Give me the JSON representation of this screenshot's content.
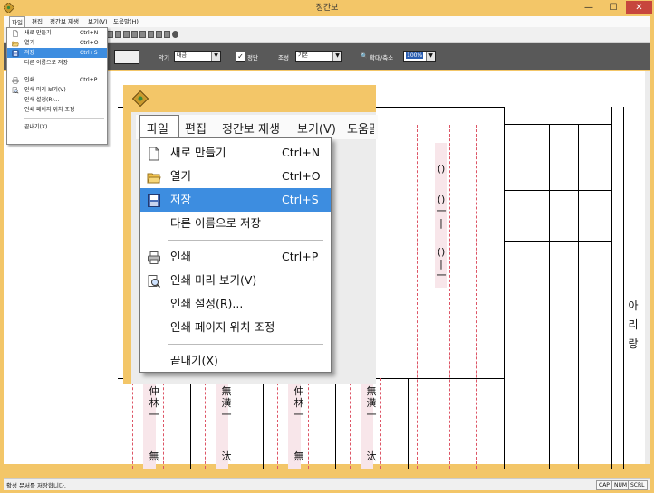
{
  "window": {
    "title": "정간보",
    "controls": {
      "minimize": "—",
      "maximize": "☐",
      "close": "✕"
    }
  },
  "menubar": [
    "파일",
    "편집",
    "정간보 재생",
    "보기(V)",
    "도움말(H)"
  ],
  "toolbar2": {
    "instrument_label": "악기",
    "instrument_value": "대금",
    "jeongdan_label": "정단",
    "jeongdan_checked": true,
    "mode_label": "조성",
    "mode_value": "기본",
    "zoom_label": "확대/축소",
    "zoom_value": "100%"
  },
  "file_menu": [
    {
      "label": "새로 만들기",
      "shortcut": "Ctrl+N",
      "icon": "new-document-icon"
    },
    {
      "label": "열기",
      "shortcut": "Ctrl+O",
      "icon": "open-folder-icon"
    },
    {
      "label": "저장",
      "shortcut": "Ctrl+S",
      "icon": "save-icon",
      "highlighted": true
    },
    {
      "label": "다른 이름으로 저장",
      "shortcut": ""
    },
    {
      "separator": true
    },
    {
      "label": "인쇄",
      "shortcut": "Ctrl+P",
      "icon": "printer-icon"
    },
    {
      "label": "인쇄 미리 보기(V)",
      "shortcut": "",
      "icon": "print-preview-icon"
    },
    {
      "label": "인쇄 설정(R)...",
      "shortcut": ""
    },
    {
      "label": "인쇄 페이지 위치 조정",
      "shortcut": ""
    },
    {
      "separator": true
    },
    {
      "label": "끝내기(X)",
      "shortcut": ""
    }
  ],
  "zoomed_menubar": [
    "파일",
    "편집",
    "정간보 재생",
    "보기(V)",
    "도움말"
  ],
  "score": {
    "title": "아리랑",
    "notes_row1": [
      "仲\n林\n一",
      "無\n潢\n一",
      "仲\n林\n一",
      "無\n潢\n一"
    ],
    "notes_row2": [
      "無",
      "汰",
      "無",
      "汰"
    ],
    "symbols_col": [
      "()",
      "()\n一\n|",
      "()\n|\n一"
    ]
  },
  "status": {
    "text": "활성 문서를 저장합니다.",
    "indicators": [
      "CAP",
      "NUM",
      "SCRL"
    ]
  },
  "colors": {
    "frame": "#f3c668",
    "highlight": "#3d8de0",
    "toolbar_dark": "#595959",
    "close": "#c7463d"
  }
}
